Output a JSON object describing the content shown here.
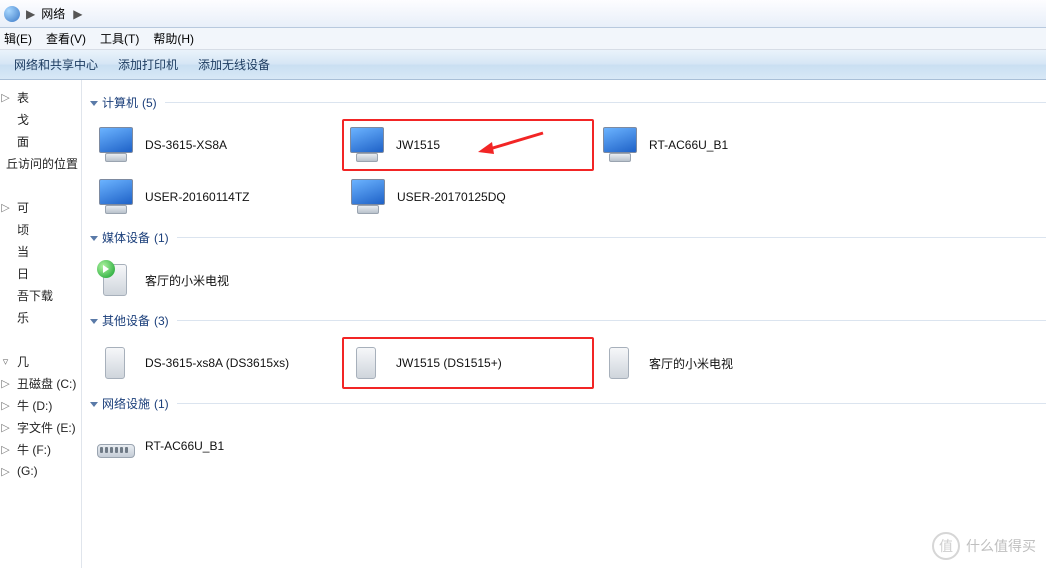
{
  "address_bar": {
    "location": "网络"
  },
  "menu": {
    "edit": "辑(E)",
    "view": "查看(V)",
    "tools": "工具(T)",
    "help": "帮助(H)"
  },
  "commands": {
    "network_center": "网络和共享中心",
    "add_printer": "添加打印机",
    "add_wireless": "添加无线设备"
  },
  "sidebar": {
    "items": [
      {
        "label": "表"
      },
      {
        "label": "戈"
      },
      {
        "label": "面"
      },
      {
        "label": "丘访问的位置"
      },
      {
        "label": ""
      },
      {
        "label": "可"
      },
      {
        "label": "顷"
      },
      {
        "label": "当"
      },
      {
        "label": "日"
      },
      {
        "label": "吾下载"
      },
      {
        "label": "乐"
      },
      {
        "label": ""
      },
      {
        "label": "几"
      },
      {
        "label": "丑磁盘 (C:)"
      },
      {
        "label": "牛 (D:)"
      },
      {
        "label": "字文件 (E:)"
      },
      {
        "label": "牛 (F:)"
      },
      {
        "label": "(G:)"
      }
    ]
  },
  "groups": {
    "computers": {
      "title": "计算机",
      "count": "(5)",
      "items": [
        {
          "label": "DS-3615-XS8A"
        },
        {
          "label": "JW1515"
        },
        {
          "label": "RT-AC66U_B1"
        },
        {
          "label": "USER-20160114TZ"
        },
        {
          "label": "USER-20170125DQ"
        }
      ]
    },
    "media": {
      "title": "媒体设备",
      "count": "(1)",
      "items": [
        {
          "label": "客厅的小米电视"
        }
      ]
    },
    "other": {
      "title": "其他设备",
      "count": "(3)",
      "items": [
        {
          "label": "DS-3615-xs8A (DS3615xs)"
        },
        {
          "label": "JW1515 (DS1515+)"
        },
        {
          "label": "客厅的小米电视"
        }
      ]
    },
    "network_infra": {
      "title": "网络设施",
      "count": "(1)",
      "items": [
        {
          "label": "RT-AC66U_B1"
        }
      ]
    }
  },
  "watermark": {
    "text": "什么值得买",
    "badge": "值"
  }
}
